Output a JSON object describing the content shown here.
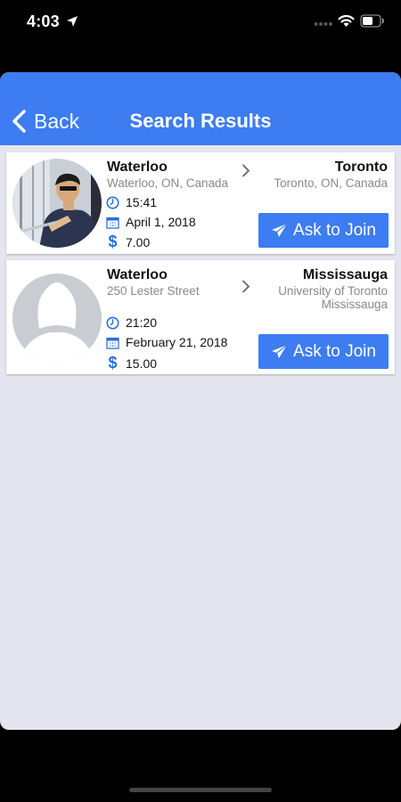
{
  "status_bar": {
    "time": "4:03"
  },
  "nav": {
    "back_label": "Back",
    "title": "Search Results"
  },
  "results": [
    {
      "from_city": "Waterloo",
      "from_address": "Waterloo, ON, Canada",
      "to_city": "Toronto",
      "to_address": "Toronto, ON, Canada",
      "time": "15:41",
      "date": "April 1, 2018",
      "price": "7.00",
      "join_label": "Ask to Join"
    },
    {
      "from_city": "Waterloo",
      "from_address": "250 Lester Street",
      "to_city": "Mississauga",
      "to_address_line1": "University of Toronto",
      "to_address_line2": "Mississauga",
      "time": "21:20",
      "date": "February 21, 2018",
      "price": "15.00",
      "join_label": "Ask to Join"
    }
  ],
  "colors": {
    "accent": "#3d7cf1",
    "background": "#e5e5ef",
    "card": "#ffffff"
  },
  "icons": [
    "location-arrow-icon",
    "signal-icon",
    "wifi-icon",
    "battery-icon",
    "back-chevron-icon",
    "chevron-right-icon",
    "clock-icon",
    "calendar-icon",
    "dollar-icon",
    "send-icon"
  ]
}
